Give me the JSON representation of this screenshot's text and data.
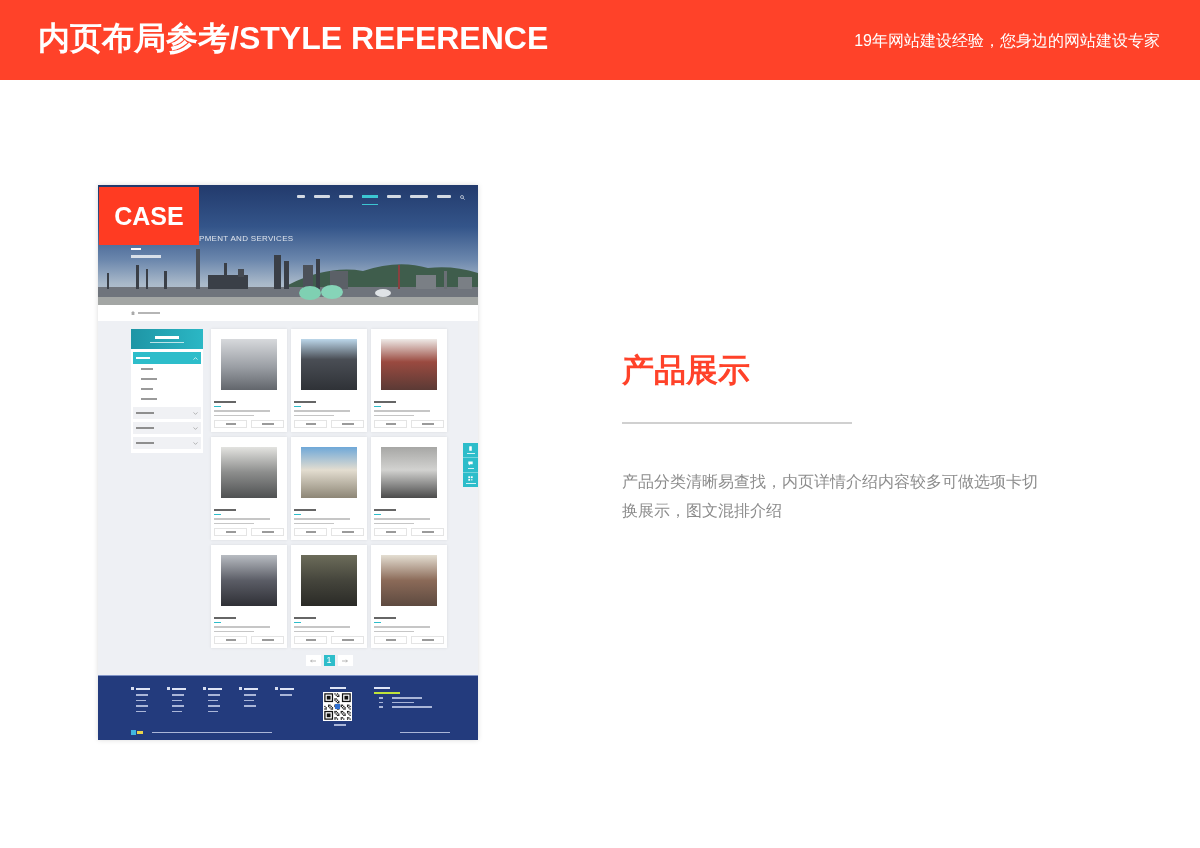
{
  "header": {
    "title": "内页布局参考/STYLE REFERENCE",
    "tagline": "19年网站建设经验，您身边的网站建设专家"
  },
  "mockup": {
    "badge": "CASE",
    "nav_items": [
      {
        "selected": false
      },
      {
        "selected": false
      },
      {
        "selected": false
      },
      {
        "selected": true
      },
      {
        "selected": false
      },
      {
        "selected": false
      },
      {
        "selected": false
      }
    ],
    "banner_subtitle": "PMENT AND SERVICES",
    "sidebar": {
      "items": [
        {
          "selected": true,
          "expanded": true,
          "children": [
            {
              "selected": false
            },
            {
              "selected": false
            },
            {
              "selected": false
            },
            {
              "selected": false
            }
          ]
        },
        {
          "selected": false,
          "expanded": false
        },
        {
          "selected": false,
          "expanded": false
        },
        {
          "selected": false,
          "expanded": false
        }
      ]
    },
    "pagination": [
      {
        "kind": "prev",
        "selected": false
      },
      {
        "kind": "page",
        "label": "1",
        "selected": true
      },
      {
        "kind": "next",
        "selected": false
      }
    ]
  },
  "section": {
    "title": "产品展示",
    "description": "产品分类清晰易查找，内页详情介绍内容较多可做选项卡切换展示，图文混排介绍"
  }
}
